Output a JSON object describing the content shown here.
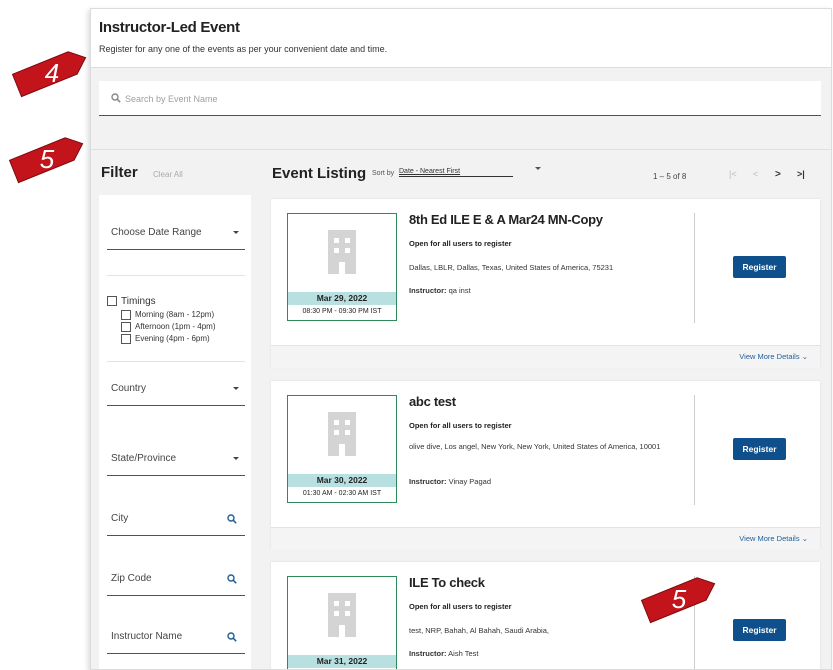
{
  "header": {
    "title": "Instructor-Led Event",
    "subtitle": "Register for any one of the events as per your convenient date and time."
  },
  "search": {
    "placeholder": "Search by Event Name",
    "value": ""
  },
  "filter": {
    "title": "Filter",
    "clear_all": "Clear All",
    "date_range": "Choose Date Range",
    "timings": {
      "label": "Timings",
      "options": [
        "Morning (8am - 12pm)",
        "Afternoon (1pm - 4pm)",
        "Evening (4pm - 6pm)"
      ]
    },
    "country": "Country",
    "state": "State/Province",
    "city": "City",
    "zip": "Zip Code",
    "instructor": "Instructor Name"
  },
  "listing": {
    "title": "Event Listing",
    "sort_label": "Sort by",
    "sort_value": "Date - Nearest First",
    "pager_text": "1 – 5 of 8",
    "pager_first": "|<",
    "pager_prev": "<",
    "pager_next": ">",
    "pager_last": ">|"
  },
  "events": [
    {
      "title": "8th Ed ILE E & A Mar24 MN-Copy",
      "open": "Open for all users to register",
      "address": "Dallas, LBLR, Dallas, Texas, United States of America, 75231",
      "instructor_label": "Instructor:",
      "instructor": "qa inst",
      "date": "Mar 29, 2022",
      "time": "08:30 PM - 09:30 PM IST",
      "register": "Register",
      "more": "View More Details"
    },
    {
      "title": "abc test",
      "open": "Open for all users to register",
      "address": "olive dive, Los angel, New York, New York, United States of America, 10001",
      "instructor_label": "Instructor:",
      "instructor": "Vinay Pagad",
      "date": "Mar 30, 2022",
      "time": "01:30 AM - 02:30 AM IST",
      "register": "Register",
      "more": "View More Details"
    },
    {
      "title": "ILE To check",
      "open": "Open for all users to register",
      "address": "test, NRP, Bahah, Al Bahah, Saudi Arabia,",
      "instructor_label": "Instructor:",
      "instructor": "Aish Test",
      "date": "Mar 31, 2022",
      "time": "",
      "register": "Register",
      "more": ""
    }
  ],
  "callouts": [
    "4",
    "5",
    "5"
  ],
  "colors": {
    "primary": "#0f4f8c",
    "callout": "#c4141b",
    "thumb_border": "#2f8a5a",
    "date_band": "#b8e0e1"
  }
}
